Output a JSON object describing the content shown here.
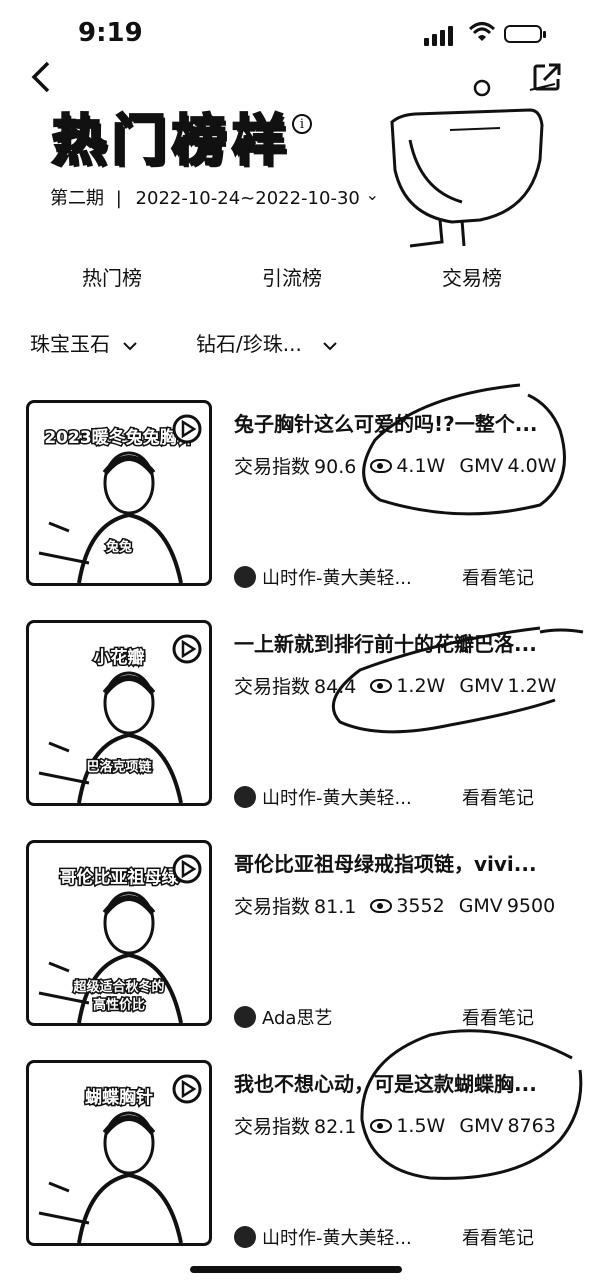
{
  "status": {
    "time": "9:19"
  },
  "header": {
    "title": "热门榜样",
    "period_label": "第二期",
    "separator": "|",
    "date_range": "2022-10-24~2022-10-30",
    "date_chevron": "⌄"
  },
  "tabs": [
    {
      "label": "热门榜"
    },
    {
      "label": "引流榜"
    },
    {
      "label": "交易榜"
    }
  ],
  "filters": [
    {
      "label": "珠宝玉石"
    },
    {
      "label": "钻石/珍珠..."
    }
  ],
  "items": [
    {
      "title": "兔子胸针这么可爱的吗!?一整个...",
      "trade_label": "交易指数",
      "trade_value": "90.6",
      "views": "4.1W",
      "gmv_label": "GMV",
      "gmv": "4.0W",
      "author": "山时作-黄大美轻...",
      "note_label": "看看笔记",
      "thumb_text": [
        "2023暖冬兔兔胸针",
        "兔兔"
      ]
    },
    {
      "title": "一上新就到排行前十的花瓣巴洛...",
      "trade_label": "交易指数",
      "trade_value": "84.4",
      "views": "1.2W",
      "gmv_label": "GMV",
      "gmv": "1.2W",
      "author": "山时作-黄大美轻...",
      "note_label": "看看笔记",
      "thumb_text": [
        "小花瓣",
        "巴洛克项链"
      ]
    },
    {
      "title": "哥伦比亚祖母绿戒指项链，vivi...",
      "trade_label": "交易指数",
      "trade_value": "81.1",
      "views": "3552",
      "gmv_label": "GMV",
      "gmv": "9500",
      "author": "Ada思艺",
      "note_label": "看看笔记",
      "thumb_text": [
        "哥伦比亚祖母绿",
        "超级适合秋冬的",
        "高性价比"
      ]
    },
    {
      "title": "我也不想心动，可是这款蝴蝶胸...",
      "trade_label": "交易指数",
      "trade_value": "82.1",
      "views": "1.5W",
      "gmv_label": "GMV",
      "gmv": "8763",
      "author": "山时作-黄大美轻...",
      "note_label": "看看笔记",
      "thumb_text": [
        "蝴蝶胸针"
      ]
    }
  ],
  "icons": [
    "back-arrow-icon",
    "share-icon",
    "info-icon",
    "signal-icon",
    "wifi-icon",
    "battery-icon",
    "eye-icon",
    "play-icon",
    "avatar"
  ]
}
